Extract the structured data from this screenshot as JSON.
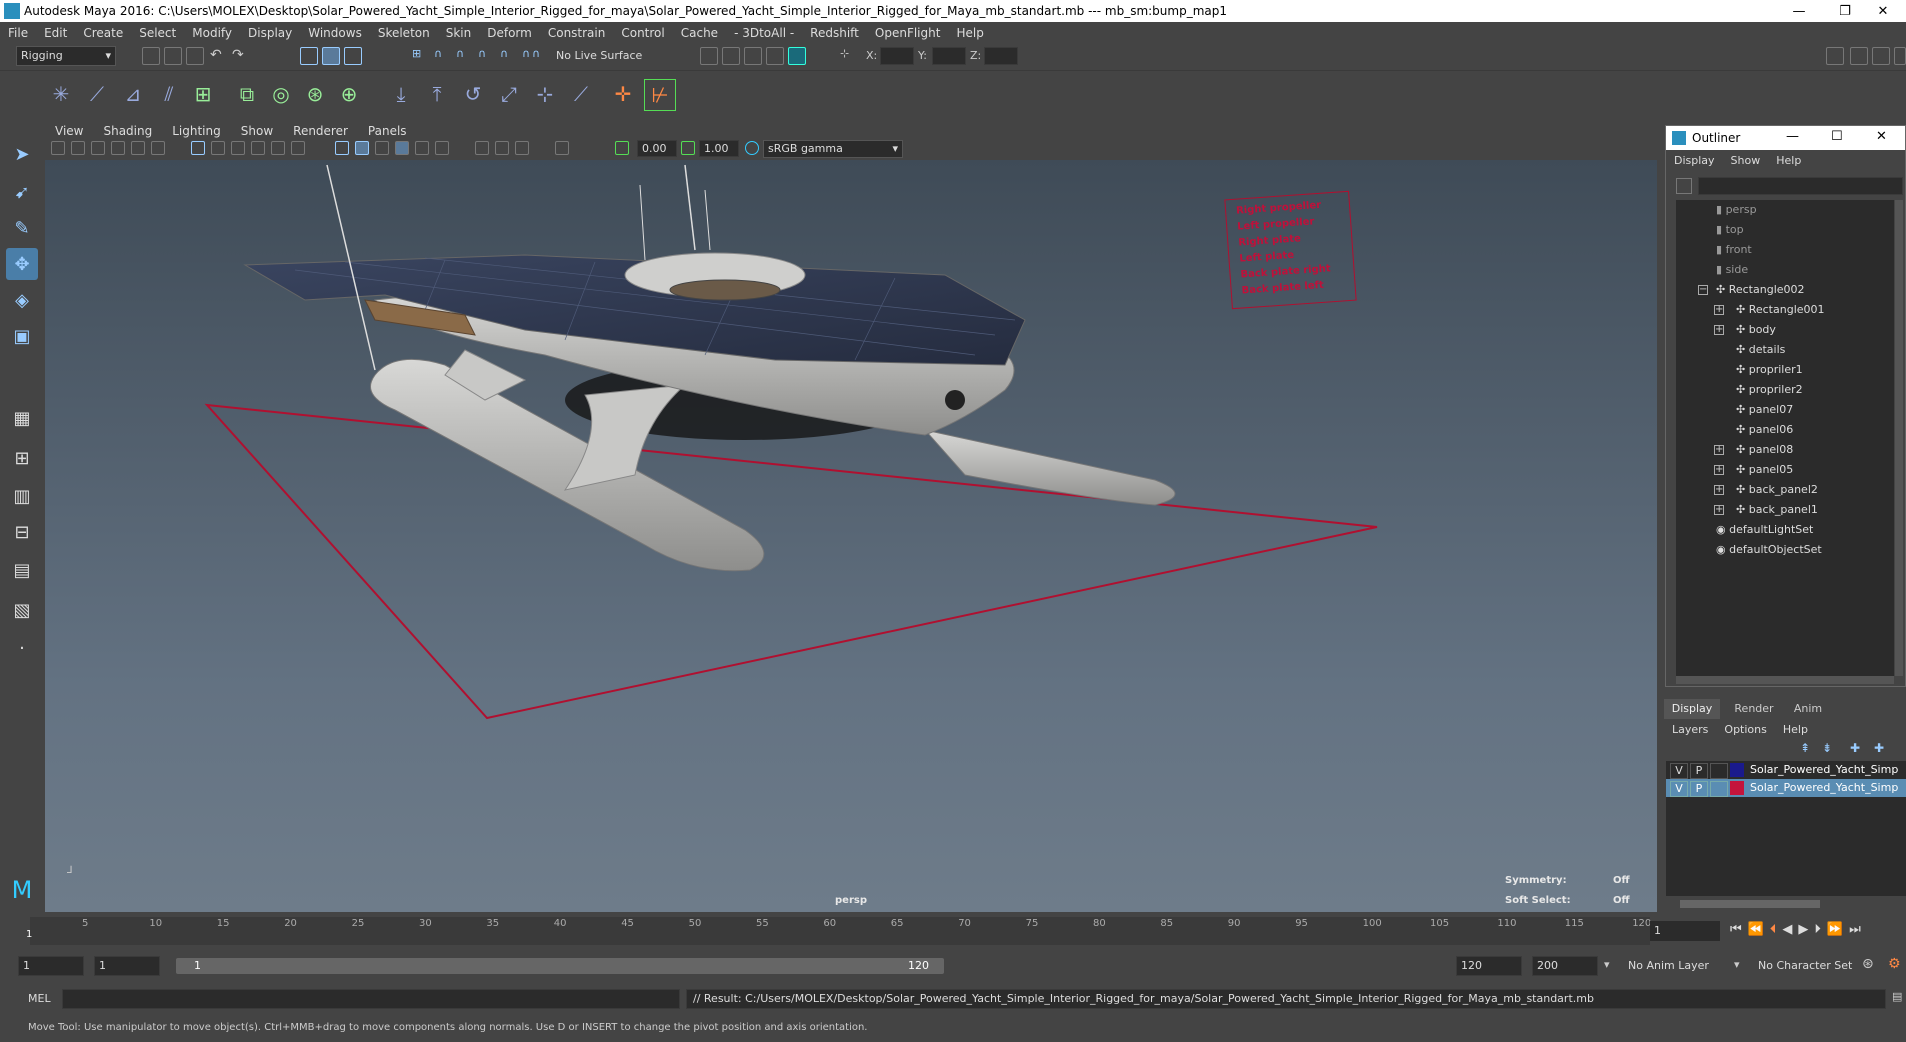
{
  "window": {
    "title": "Autodesk Maya 2016: C:\\Users\\MOLEX\\Desktop\\Solar_Powered_Yacht_Simple_Interior_Rigged_for_maya\\Solar_Powered_Yacht_Simple_Interior_Rigged_for_Maya_mb_standart.mb   ---   mb_sm:bump_map1",
    "minimize": "—",
    "restore": "❐",
    "close": "✕"
  },
  "menubar": [
    "File",
    "Edit",
    "Create",
    "Select",
    "Modify",
    "Display",
    "Windows",
    "Skeleton",
    "Skin",
    "Deform",
    "Constrain",
    "Control",
    "Cache",
    "- 3DtoAll -",
    "Redshift",
    "OpenFlight",
    "Help"
  ],
  "statusline": {
    "mode": "Rigging",
    "live_surface": "No Live Surface",
    "x_label": "X:",
    "y_label": "Y:",
    "z_label": "Z:"
  },
  "viewport": {
    "menu": [
      "View",
      "Shading",
      "Lighting",
      "Show",
      "Renderer",
      "Panels"
    ],
    "exposure": "0.00",
    "gamma": "1.00",
    "color_space": "sRGB gamma",
    "camera_label": "persp",
    "hud": {
      "symmetry_label": "Symmetry:",
      "symmetry_value": "Off",
      "soft_select_label": "Soft Select:",
      "soft_select_value": "Off"
    },
    "control_panel": [
      "Right propeller",
      "Left propeller",
      "Right plate",
      "Left plate",
      "Back plate right",
      "Back plate left"
    ]
  },
  "outliner": {
    "title": "Outliner",
    "menu": [
      "Display",
      "Show",
      "Help"
    ],
    "items": [
      {
        "label": "persp",
        "grey": true
      },
      {
        "label": "top",
        "grey": true
      },
      {
        "label": "front",
        "grey": true
      },
      {
        "label": "side",
        "grey": true
      },
      {
        "label": "Rectangle002",
        "grey": false
      },
      {
        "label": "Rectangle001",
        "grey": false
      },
      {
        "label": "body",
        "grey": false
      },
      {
        "label": "details",
        "grey": false
      },
      {
        "label": "propriler1",
        "grey": false
      },
      {
        "label": "propriler2",
        "grey": false
      },
      {
        "label": "panel07",
        "grey": false
      },
      {
        "label": "panel06",
        "grey": false
      },
      {
        "label": "panel08",
        "grey": false
      },
      {
        "label": "panel05",
        "grey": false
      },
      {
        "label": "back_panel2",
        "grey": false
      },
      {
        "label": "back_panel1",
        "grey": false
      },
      {
        "label": "defaultLightSet",
        "grey": false
      },
      {
        "label": "defaultObjectSet",
        "grey": false
      }
    ]
  },
  "layers": {
    "tabs": [
      "Display",
      "Render",
      "Anim"
    ],
    "menu": [
      "Layers",
      "Options",
      "Help"
    ],
    "rows": [
      {
        "v": "V",
        "p": "P",
        "color": "#1a1a8c",
        "name": "Solar_Powered_Yacht_Simp"
      },
      {
        "v": "V",
        "p": "P",
        "color": "#c4143c",
        "name": "Solar_Powered_Yacht_Simp"
      }
    ]
  },
  "timeline": {
    "ticks": [
      "5",
      "10",
      "15",
      "20",
      "25",
      "30",
      "35",
      "40",
      "45",
      "50",
      "55",
      "60",
      "65",
      "70",
      "75",
      "80",
      "85",
      "90",
      "95",
      "100",
      "105",
      "110",
      "115",
      "120"
    ],
    "start_marker": "1",
    "current_frame": "1"
  },
  "range": {
    "start": "1",
    "start2": "1",
    "slider_start": "1",
    "slider_end": "120",
    "end": "120",
    "max": "200",
    "anim_layer": "No Anim Layer",
    "character_set": "No Character Set"
  },
  "cmdline": {
    "mode": "MEL",
    "result": "// Result: C:/Users/MOLEX/Desktop/Solar_Powered_Yacht_Simple_Interior_Rigged_for_maya/Solar_Powered_Yacht_Simple_Interior_Rigged_for_Maya_mb_standart.mb"
  },
  "helpline": "Move Tool: Use manipulator to move object(s). Ctrl+MMB+drag to move components along normals. Use D or INSERT to change the pivot position and axis orientation."
}
